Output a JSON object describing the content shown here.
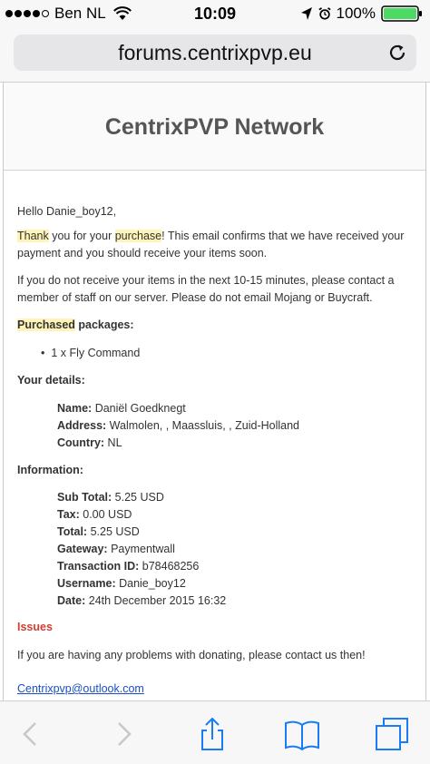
{
  "status_bar": {
    "carrier": "Ben NL",
    "time": "10:09",
    "battery": "100%"
  },
  "browser": {
    "url": "forums.centrixpvp.eu"
  },
  "email": {
    "brand": "CentrixPVP Network",
    "greeting": "Hello Danie_boy12,",
    "thank_hl": "Thank",
    "thank_mid": " you for your ",
    "thank_purchase": "purchase",
    "thank_rest": "! This email confirms that we have received your payment and you should receive your items soon.",
    "notice": "If you do not receive your items in the next 10-15 minutes, please contact a member of staff on our server. Please do not email Mojang or Buycraft.",
    "packages_hl": "Purchased",
    "packages_rest": " packages:",
    "package_item": "1 x Fly Command",
    "details_heading": "Your details:",
    "details": {
      "name_label": "Name:",
      "name_value": " Daniël Goedknegt",
      "address_label": "Address:",
      "address_value": " Walmolen, , Maassluis, , Zuid-Holland",
      "country_label": "Country:",
      "country_value": " NL"
    },
    "info_heading": "Information:",
    "info": {
      "subtotal_label": "Sub Total:",
      "subtotal_value": " 5.25 USD",
      "tax_label": "Tax:",
      "tax_value": " 0.00 USD",
      "total_label": "Total:",
      "total_value": " 5.25 USD",
      "gateway_label": "Gateway:",
      "gateway_value": " Paymentwall",
      "txn_label": "Transaction ID:",
      "txn_value": " b78468256",
      "username_label": "Username:",
      "username_value": " Danie_boy12",
      "date_label": "Date:",
      "date_value": " 24th December 2015 16:32"
    },
    "issues_heading": "Issues",
    "issues_text": "If you are having any problems with donating, please contact us then!",
    "contact_email": "Centrixpvp@outlook.com"
  },
  "toolbar": {
    "icons": [
      "back-icon",
      "forward-icon",
      "share-icon",
      "bookmarks-icon",
      "tabs-icon"
    ],
    "accent": "#1a7cf5",
    "disabled": "#c7c7cc"
  }
}
